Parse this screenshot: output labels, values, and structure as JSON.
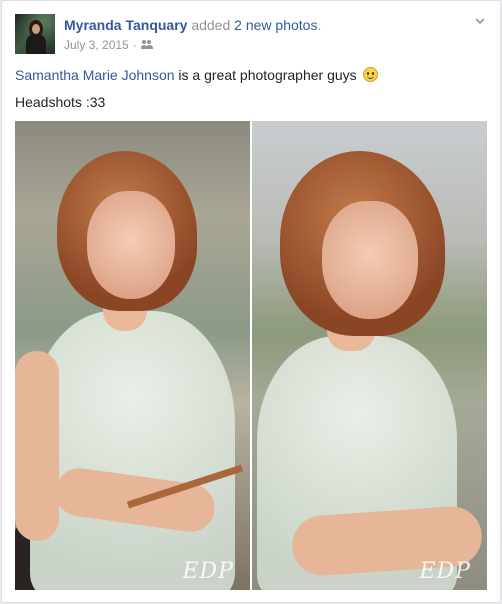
{
  "post": {
    "author": "Myranda Tanquary",
    "action_prefix": "added",
    "action_link": "2 new photos",
    "action_suffix": ".",
    "date": "July 3, 2015",
    "separator": "·",
    "audience_icon": "friends-icon",
    "text_tag": "Samantha Marie Johnson",
    "text_rest": " is a great photographer guys",
    "emoji": "smile-emoji",
    "text_line2": "Headshots :33"
  },
  "photos": [
    {
      "watermark": "EDP"
    },
    {
      "watermark": "EDP"
    }
  ],
  "colors": {
    "link": "#365899",
    "meta": "#90949c",
    "text": "#1d2129",
    "background": "#e9ebee"
  }
}
